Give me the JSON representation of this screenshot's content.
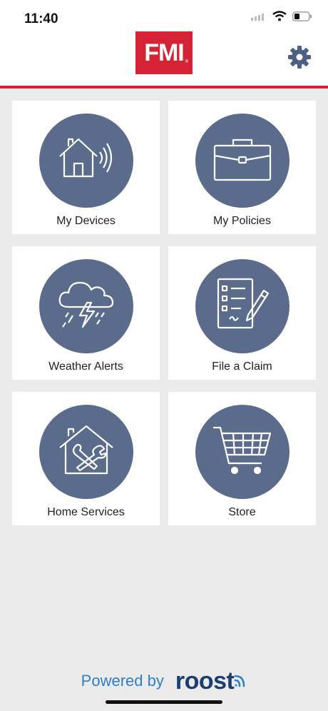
{
  "status": {
    "time": "11:40"
  },
  "header": {
    "logo_text": "FMI",
    "logo_mark": "®"
  },
  "tiles": [
    {
      "label": "My Devices",
      "icon": "house-signal-icon"
    },
    {
      "label": "My Policies",
      "icon": "briefcase-icon"
    },
    {
      "label": "Weather Alerts",
      "icon": "storm-cloud-icon"
    },
    {
      "label": "File a Claim",
      "icon": "claim-form-icon"
    },
    {
      "label": "Home Services",
      "icon": "home-tools-icon"
    },
    {
      "label": "Store",
      "icon": "shopping-cart-icon"
    }
  ],
  "footer": {
    "powered_by": "Powered by",
    "brand": "roost"
  },
  "colors": {
    "accent": "#d52234",
    "tile_circle": "#5a6b8c",
    "powered": "#2f80c9",
    "brand": "#1b3e73",
    "gear": "#4d5f82"
  }
}
